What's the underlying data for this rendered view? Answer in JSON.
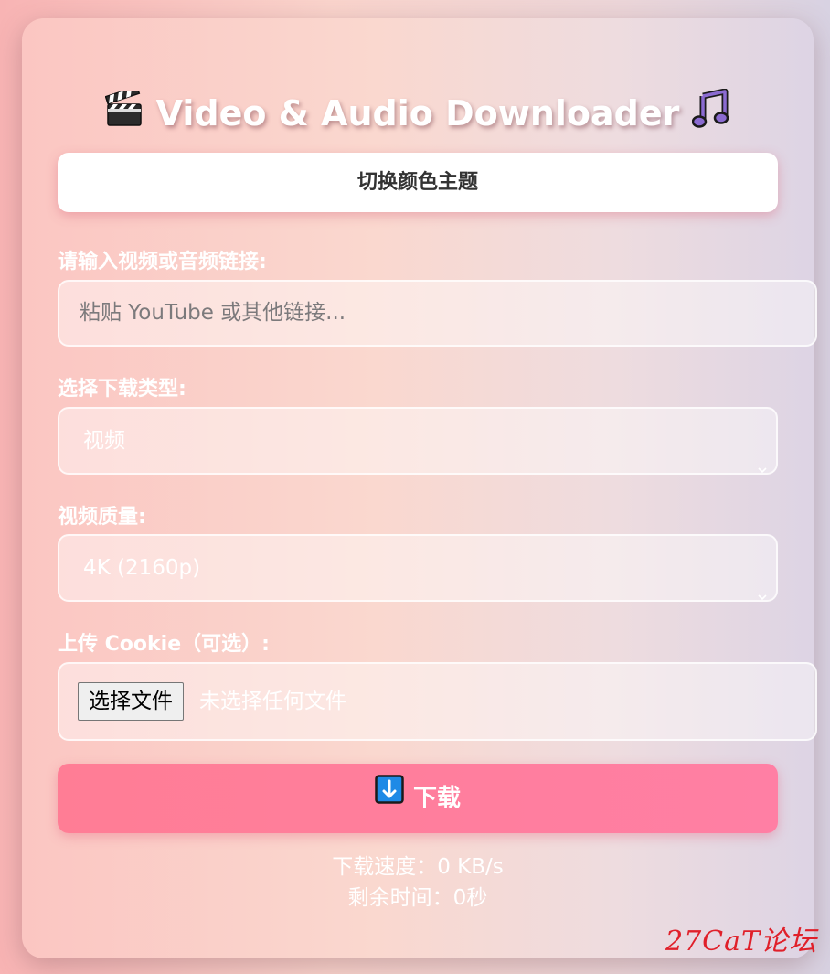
{
  "header": {
    "title": "Video & Audio Downloader",
    "left_icon": "clapper-board-icon",
    "right_icon": "music-note-icon"
  },
  "theme_toggle": {
    "label": "切换颜色主题"
  },
  "url_section": {
    "label": "请输入视频或音频链接:",
    "placeholder": "粘贴 YouTube 或其他链接...",
    "value": ""
  },
  "type_section": {
    "label": "选择下载类型:",
    "selected": "视频"
  },
  "quality_section": {
    "label": "视频质量:",
    "selected": "4K (2160p)"
  },
  "cookie_section": {
    "label": "上传 Cookie（可选）:",
    "button_label": "选择文件",
    "status": "未选择任何文件"
  },
  "download": {
    "label": "下载",
    "icon": "down-arrow-icon"
  },
  "progress": {
    "speed_text": "下载速度：0 KB/s",
    "remaining_text": "剩余时间：0秒"
  },
  "watermark": {
    "text": "27CaT论坛"
  },
  "colors": {
    "download_button": "#ff7d95",
    "theme_button": "#ffffff",
    "text_light": "#ffffff",
    "watermark": "#e0202a"
  }
}
